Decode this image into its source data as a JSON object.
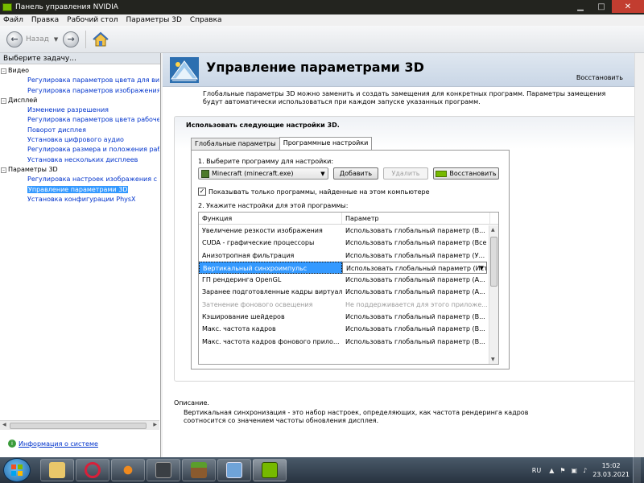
{
  "window": {
    "title": "Панель управления NVIDIA"
  },
  "menu": [
    "Файл",
    "Правка",
    "Рабочий стол",
    "Параметры 3D",
    "Справка"
  ],
  "toolbar": {
    "back_label": "Назад"
  },
  "left": {
    "header": "Выберите задачу...",
    "tree": [
      {
        "label": "Видео",
        "level": 0,
        "expander": "–"
      },
      {
        "label": "Регулировка параметров цвета для видео",
        "level": 1
      },
      {
        "label": "Регулировка параметров изображения для видео",
        "level": 1
      },
      {
        "label": "Дисплей",
        "level": 0,
        "expander": "–"
      },
      {
        "label": "Изменение разрешения",
        "level": 1
      },
      {
        "label": "Регулировка параметров цвета рабочего стола",
        "level": 1
      },
      {
        "label": "Поворот дисплея",
        "level": 1
      },
      {
        "label": "Установка цифрового аудио",
        "level": 1
      },
      {
        "label": "Регулировка размера и положения рабочего стола",
        "level": 1
      },
      {
        "label": "Установка нескольких дисплеев",
        "level": 1
      },
      {
        "label": "Параметры 3D",
        "level": 0,
        "expander": "–"
      },
      {
        "label": "Регулировка настроек изображения с просмотром",
        "level": 1
      },
      {
        "label": "Управление параметрами 3D",
        "level": 1,
        "selected": true
      },
      {
        "label": "Установка конфигурации PhysX",
        "level": 1
      }
    ],
    "sysinfo": "Информация о системе"
  },
  "page": {
    "title": "Управление параметрами 3D",
    "restore": "Восстановить",
    "intro": "Глобальные параметры 3D можно заменить и создать замещения для конкретных программ. Параметры замещения будут автоматически использоваться при каждом запуске указанных программ.",
    "use_label": "Использовать следующие настройки 3D.",
    "tabs": [
      "Глобальные параметры",
      "Программные настройки"
    ],
    "step1": "1. Выберите программу для настройки:",
    "program": "Minecraft (minecraft.exe)",
    "add": "Добавить",
    "remove": "Удалить",
    "restore_btn": "Восстановить",
    "checkbox": "Показывать только программы, найденные на этом компьютере",
    "step2": "2. Укажите настройки для этой программы:",
    "col_func": "Функция",
    "col_param": "Параметр",
    "rows": [
      {
        "f": "Увеличение резкости изображения",
        "p": "Использовать глобальный параметр (В..."
      },
      {
        "f": "CUDA - графические процессоры",
        "p": "Использовать глобальный параметр (Все)"
      },
      {
        "f": "Анизотропная фильтрация",
        "p": "Использовать глобальный параметр (У..."
      },
      {
        "f": "Вертикальный синхроимпульс",
        "p": "Использовать глобальный параметр (Ист",
        "selected": true
      },
      {
        "f": "ГП рендеринга OpenGL",
        "p": "Использовать глобальный параметр (А..."
      },
      {
        "f": "Заранее подготовленные кадры виртуальной ...",
        "p": "Использовать глобальный параметр (А..."
      },
      {
        "f": "Затенение фонового освещения",
        "p": "Не поддерживается для этого приложе...",
        "dim": true
      },
      {
        "f": "Кэширование шейдеров",
        "p": "Использовать глобальный параметр (В..."
      },
      {
        "f": "Макс. частота кадров",
        "p": "Использовать глобальный параметр (В..."
      },
      {
        "f": "Макс. частота кадров фонового прило...",
        "p": "Использовать глобальный параметр (В..."
      }
    ],
    "desc_label": "Описание.",
    "desc": "Вертикальная синхронизация - это набор настроек, определяющих, как частота рендеринга кадров соотносится со значением частоты обновления дисплея."
  },
  "taskbar": {
    "lang": "RU",
    "time": "15:02",
    "date": "23.03.2021"
  }
}
